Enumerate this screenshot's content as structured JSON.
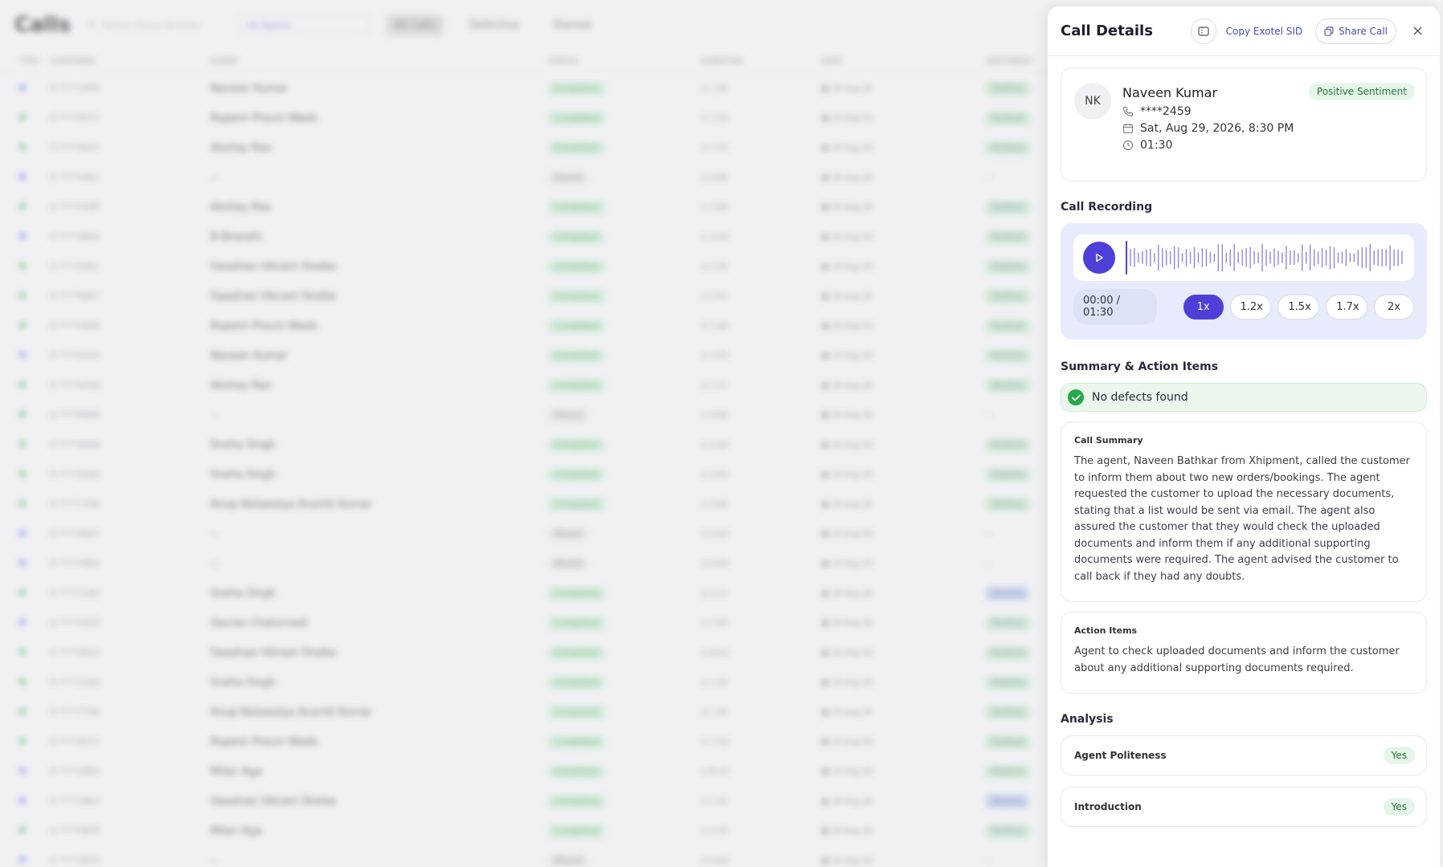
{
  "background": {
    "page_title": "Calls",
    "search_placeholder": "Search Phone Number",
    "agent_filter": "All Agents",
    "tabs": [
      "All Calls",
      "Defective",
      "Starred"
    ],
    "columns": [
      "TYPE",
      "CUSTOMER",
      "AGENT",
      "STATUS",
      "DURATION",
      "DATE",
      "SENTIMENT"
    ],
    "rows": [
      {
        "type": "out",
        "customer": "*****2459",
        "agent": "Naveen Kumar",
        "status": "Completed",
        "duration": "1:30",
        "date": "29 Aug 26",
        "sentiment": "Positive"
      },
      {
        "type": "in",
        "customer": "*****9271",
        "agent": "Rupesh Pravin Wade",
        "status": "Completed",
        "duration": "1:15",
        "date": "29 Aug 26",
        "sentiment": "Positive"
      },
      {
        "type": "in",
        "customer": "*****8327",
        "agent": "Akshay Rao",
        "status": "Completed",
        "duration": "1:21",
        "date": "29 Aug 26",
        "sentiment": "Positive"
      },
      {
        "type": "out",
        "customer": "*****4497",
        "agent": "--",
        "status": "Missed",
        "duration": "0:00",
        "date": "29 Aug 26",
        "sentiment": "--"
      },
      {
        "type": "in",
        "customer": "*****2185",
        "agent": "Akshay Rao",
        "status": "Completed",
        "duration": "3:04",
        "date": "29 Aug 26",
        "sentiment": "Positive"
      },
      {
        "type": "out",
        "customer": "*****8834",
        "agent": "B Bharath",
        "status": "Completed",
        "duration": "3:18",
        "date": "29 Aug 26",
        "sentiment": "Positive"
      },
      {
        "type": "in",
        "customer": "*****5921",
        "agent": "Swadrasi Vikrant Shelke",
        "status": "Completed",
        "duration": "2:32",
        "date": "29 Aug 26",
        "sentiment": "Positive"
      },
      {
        "type": "in",
        "customer": "*****6057",
        "agent": "Swadrasi Vikrant Shelke",
        "status": "Completed",
        "duration": "2:07",
        "date": "29 Aug 26",
        "sentiment": "Positive"
      },
      {
        "type": "in",
        "customer": "*****3036",
        "agent": "Rupesh Pravin Wade",
        "status": "Completed",
        "duration": "1:46",
        "date": "29 Aug 26",
        "sentiment": "Positive"
      },
      {
        "type": "out",
        "customer": "*****0153",
        "agent": "Naveen Kumar",
        "status": "Completed",
        "duration": "1:05",
        "date": "29 Aug 26",
        "sentiment": "Positive"
      },
      {
        "type": "in",
        "customer": "*****0759",
        "agent": "Akshay Rao",
        "status": "Completed",
        "duration": "1:17",
        "date": "29 Aug 26",
        "sentiment": "Positive"
      },
      {
        "type": "in",
        "customer": "*****6009",
        "agent": "--",
        "status": "Missed",
        "duration": "0:00",
        "date": "29 Aug 26",
        "sentiment": "--"
      },
      {
        "type": "in",
        "customer": "*****6049",
        "agent": "Sneha Singh",
        "status": "Completed",
        "duration": "2:05",
        "date": "29 Aug 26",
        "sentiment": "Positive"
      },
      {
        "type": "in",
        "customer": "*****0183",
        "agent": "Sneha Singh",
        "status": "Completed",
        "duration": "3:03",
        "date": "29 Aug 26",
        "sentiment": "Positive"
      },
      {
        "type": "in",
        "customer": "*****7708",
        "agent": "Anup Nalawalya Anantk Kumar",
        "status": "Completed",
        "duration": "4:00",
        "date": "29 Aug 26",
        "sentiment": "Positive"
      },
      {
        "type": "out",
        "customer": "*****9027",
        "agent": "--",
        "status": "Missed",
        "duration": "0:00",
        "date": "29 Aug 26",
        "sentiment": "--"
      },
      {
        "type": "out",
        "customer": "*****7803",
        "agent": "--",
        "status": "Missed",
        "duration": "0:00",
        "date": "29 Aug 26",
        "sentiment": "--"
      },
      {
        "type": "in",
        "customer": "*****1183",
        "agent": "Sneha Singh",
        "status": "Completed",
        "duration": "3:13",
        "date": "29 Aug 26",
        "sentiment": "Neutral"
      },
      {
        "type": "out",
        "customer": "*****3220",
        "agent": "Saurav Chaturvedi",
        "status": "Completed",
        "duration": "2:03",
        "date": "29 Aug 26",
        "sentiment": "Positive"
      },
      {
        "type": "in",
        "customer": "*****0522",
        "agent": "Swadrasi Vikrant Shelke",
        "status": "Completed",
        "duration": "8:02",
        "date": "29 Aug 26",
        "sentiment": "Positive"
      },
      {
        "type": "in",
        "customer": "*****1183",
        "agent": "Sneha Singh",
        "status": "Completed",
        "duration": "1:22",
        "date": "29 Aug 26",
        "sentiment": "Positive"
      },
      {
        "type": "in",
        "customer": "*****7748",
        "agent": "Anup Nalawalya Anantk Kumar",
        "status": "Completed",
        "duration": "1:05",
        "date": "29 Aug 26",
        "sentiment": "Positive"
      },
      {
        "type": "in",
        "customer": "*****9271",
        "agent": "Rupesh Pravin Wade",
        "status": "Completed",
        "duration": "1:18",
        "date": "29 Aug 26",
        "sentiment": "Positive"
      },
      {
        "type": "out",
        "customer": "*****2853",
        "agent": "Milan Aga",
        "status": "Completed",
        "duration": "8:13",
        "date": "29 Aug 26",
        "sentiment": "Positive"
      },
      {
        "type": "out",
        "customer": "*****2803",
        "agent": "Swadrasi Vikrant Shelke",
        "status": "Completed",
        "duration": "2:41",
        "date": "29 Aug 26",
        "sentiment": "Neutral"
      },
      {
        "type": "in",
        "customer": "*****5879",
        "agent": "Milan Aga",
        "status": "Completed",
        "duration": "2:10",
        "date": "29 Aug 26",
        "sentiment": "Positive"
      },
      {
        "type": "out",
        "customer": "*****3079",
        "agent": "--",
        "status": "Missed",
        "duration": "0:00",
        "date": "29 Aug 26",
        "sentiment": "--"
      }
    ]
  },
  "panel": {
    "title": "Call Details",
    "copy_sid_label": "Copy Exotel SID",
    "share_label": "Share Call",
    "contact": {
      "initials": "NK",
      "name": "Naveen Kumar",
      "phone": "****2459",
      "datetime": "Sat, Aug 29, 2026, 8:30 PM",
      "duration": "01:30",
      "sentiment": "Positive Sentiment"
    },
    "recording": {
      "title": "Call Recording",
      "time": "00:00 / 01:30",
      "speeds": [
        "1x",
        "1.2x",
        "1.5x",
        "1.7x",
        "2x"
      ],
      "active_speed": "1x"
    },
    "summary": {
      "title": "Summary & Action Items",
      "defects": "No defects found",
      "call_summary_label": "Call Summary",
      "call_summary": "The agent, Naveen Bathkar from Xhipment, called the customer to inform them about two new orders/bookings. The agent requested the customer to upload the necessary documents, stating that a list would be sent via email. The agent also assured the customer that they would check the uploaded documents and inform them if any additional supporting documents were required. The agent advised the customer to call back if they had any doubts.",
      "action_items_label": "Action Items",
      "action_items": "Agent to check uploaded documents and inform the customer about any additional supporting documents required."
    },
    "analysis": {
      "title": "Analysis",
      "items": [
        {
          "label": "Agent Politeness",
          "value": "Yes"
        },
        {
          "label": "Introduction",
          "value": "Yes"
        }
      ]
    }
  },
  "colors": {
    "accent": "#4d3fd8",
    "positive": "#27a84a",
    "link": "#4a4ab8"
  }
}
